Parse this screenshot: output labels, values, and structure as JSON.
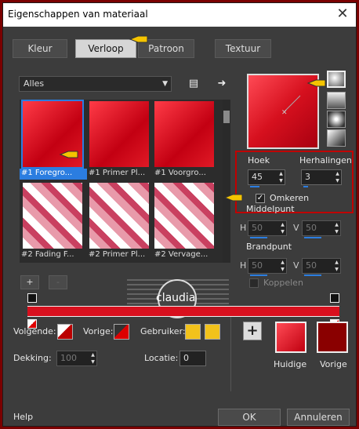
{
  "window": {
    "title": "Eigenschappen van materiaal",
    "close_glyph": "✕"
  },
  "tabs": [
    {
      "label": "Kleur"
    },
    {
      "label": "Verloop"
    },
    {
      "label": "Patroon"
    },
    {
      "label": "Textuur"
    }
  ],
  "library": {
    "category": "Alles",
    "thumbnails": [
      {
        "label": "#1 Foregro...",
        "selected": true
      },
      {
        "label": "#1 Primer Pl...",
        "selected": false
      },
      {
        "label": "#1 Voorgro...",
        "selected": false
      },
      {
        "label": "#2 Fading F...",
        "selected": false
      },
      {
        "label": "#2 Primer Pl...",
        "selected": false
      },
      {
        "label": "#2 Vervage...",
        "selected": false
      }
    ]
  },
  "gradient": {
    "angle_label": "Hoek",
    "angle_value": "45",
    "repeats_label": "Herhalingen",
    "repeats_value": "3",
    "invert_label": "Omkeren",
    "invert_checked": true,
    "center_label": "Middelpunt",
    "center_h_label": "H",
    "center_h_value": "50",
    "center_v_label": "V",
    "center_v_value": "50",
    "focal_label": "Brandpunt",
    "focal_h_label": "H",
    "focal_h_value": "50",
    "focal_v_label": "V",
    "focal_v_value": "50",
    "link_label": "Koppelen",
    "link_checked": false
  },
  "editor": {
    "add_stop": "+",
    "remove_stop": "-",
    "watermark_text": "claudia"
  },
  "stops": {
    "next_label": "Volgende:",
    "previous_label": "Vorige:",
    "user_label": "Gebruiker:",
    "opacity_label": "Dekking:",
    "opacity_value": "100",
    "location_label": "Locatie:",
    "location_value": "0"
  },
  "swatches": {
    "add_glyph": "+",
    "current_label": "Huidige",
    "previous_label": "Vorige",
    "current_color": "#e0101c",
    "previous_color": "#8a0000"
  },
  "footer": {
    "help_label": "Help",
    "ok_label": "OK",
    "cancel_label": "Annuleren"
  },
  "colors": {
    "accent": "#2b7de0",
    "gradient_red": "#d8101e",
    "user_yellow": "#f2c21b",
    "highlight_box": "#c00000"
  }
}
